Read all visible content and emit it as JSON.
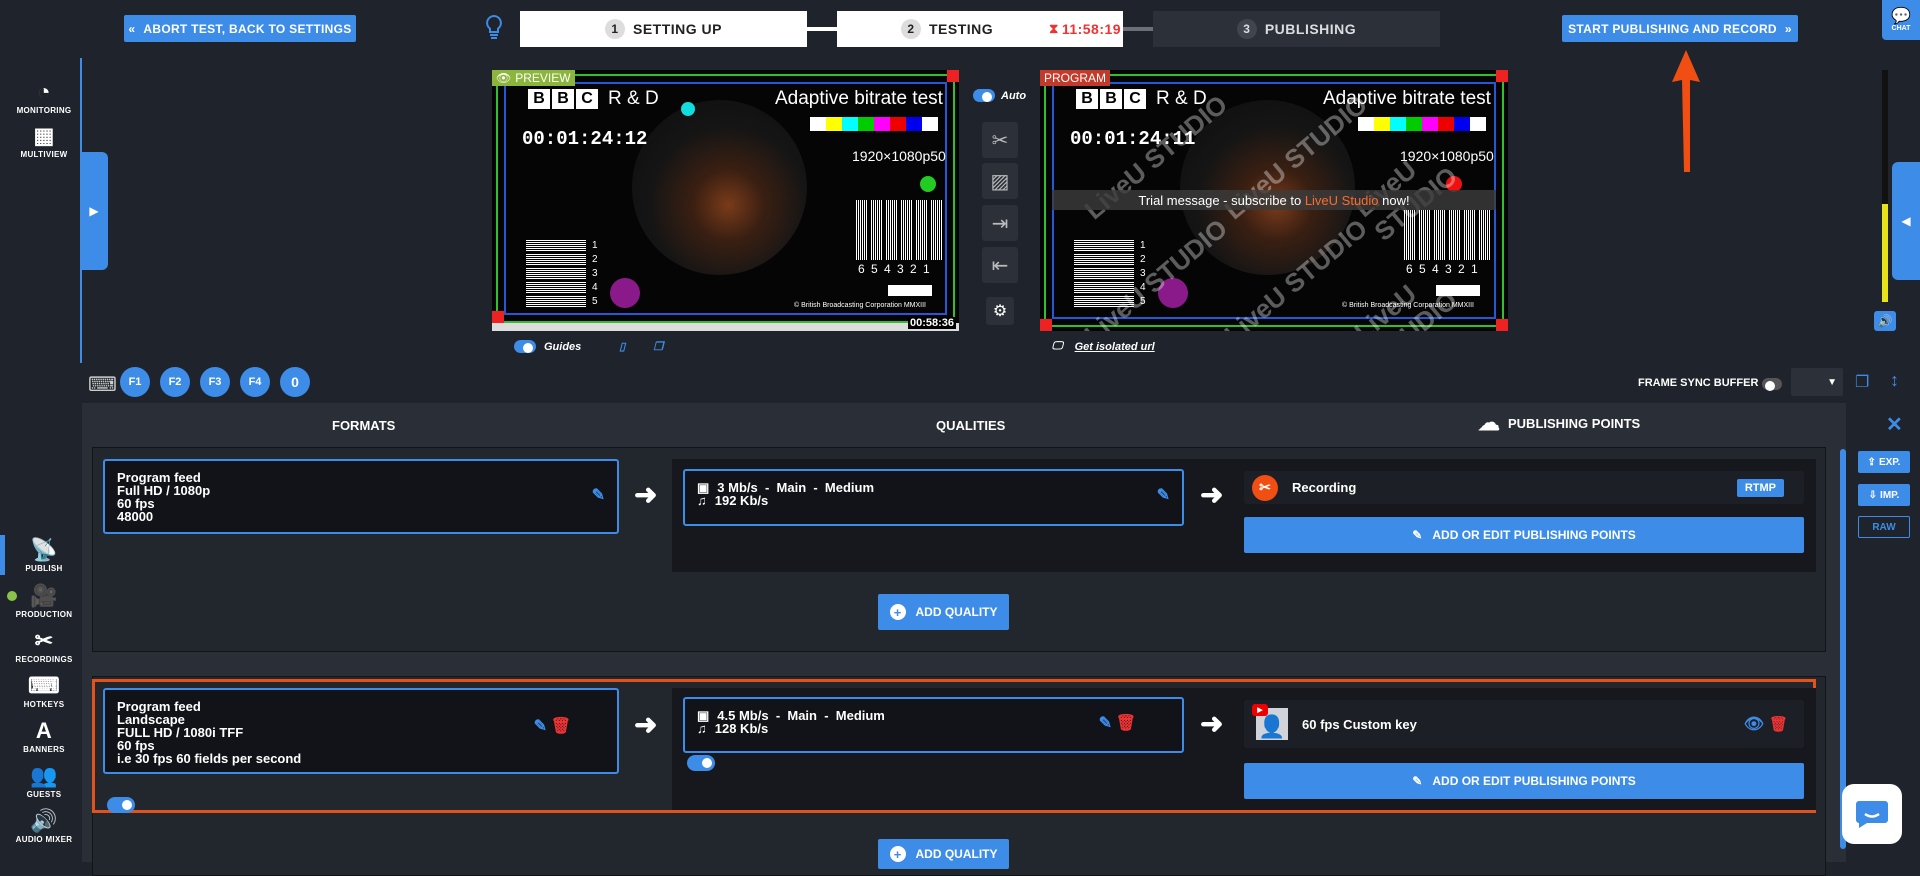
{
  "topbar": {
    "abort_label": "ABORT TEST, BACK TO SETTINGS",
    "steps": [
      {
        "num": "1",
        "label": "SETTING UP"
      },
      {
        "num": "2",
        "label": "TESTING",
        "timer": "11:58:19"
      },
      {
        "num": "3",
        "label": "PUBLISHING"
      }
    ],
    "start_label": "START PUBLISHING AND RECORD",
    "chat_label": "CHAT"
  },
  "nav": {
    "top": [
      {
        "label": "MONITORING",
        "icon": "gauge-icon"
      },
      {
        "label": "MULTIVIEW",
        "icon": "grid-icon"
      }
    ],
    "bottom": [
      {
        "label": "PUBLISH",
        "icon": "satellite-icon"
      },
      {
        "label": "PRODUCTION",
        "icon": "camera-icon"
      },
      {
        "label": "RECORDINGS",
        "icon": "scissors-icon"
      },
      {
        "label": "HOTKEYS",
        "icon": "keyboard-icon"
      },
      {
        "label": "BANNERS",
        "icon": "letter-a-icon"
      },
      {
        "label": "GUESTS",
        "icon": "users-icon"
      },
      {
        "label": "AUDIO MIXER",
        "icon": "speaker-icon"
      }
    ]
  },
  "preview": {
    "label": "PREVIEW",
    "brand": "R & D",
    "title": "Adaptive bitrate test",
    "timecode": "00:01:24:12",
    "resolution": "1920×1080p50",
    "bar_numbers": "6 5 4 3 2 1",
    "hbar_numbers": [
      "1",
      "2",
      "3",
      "4",
      "5"
    ],
    "copyright": "© British Broadcasting Corporation MMXIII",
    "remaining": "00:58:36",
    "guides_label": "Guides"
  },
  "program": {
    "label": "PROGRAM",
    "brand": "R & D",
    "title": "Adaptive bitrate test",
    "timecode": "00:01:24:11",
    "resolution": "1920×1080p50",
    "bar_numbers": "6 5 4 3 2 1",
    "hbar_numbers": [
      "1",
      "2",
      "3",
      "4",
      "5"
    ],
    "copyright": "© British Broadcasting Corporation MMXIII",
    "watermark": "LiveU STUDIO",
    "trial_prefix": "Trial message - subscribe to ",
    "trial_brand": "LiveU Studio",
    "trial_suffix": " now!",
    "isolated_url": "Get isolated url"
  },
  "tools": {
    "auto_label": "Auto"
  },
  "hotkeys": [
    "F1",
    "F2",
    "F3",
    "F4",
    "0"
  ],
  "frame_sync_label": "FRAME SYNC BUFFER",
  "headers": {
    "formats": "FORMATS",
    "qualities": "QUALITIES",
    "publishing_points": "PUBLISHING POINTS"
  },
  "groups": [
    {
      "format_lines": [
        "Program feed",
        "Full HD / 1080p",
        "60 fps",
        "48000"
      ],
      "quality_video": "3 Mb/s  -  Main  -  Medium",
      "quality_audio": "192 Kb/s",
      "point_name": "Recording",
      "point_tag": "RTMP",
      "add_points_label": "ADD OR EDIT PUBLISHING POINTS",
      "add_quality_label": "ADD QUALITY"
    },
    {
      "format_lines": [
        "Program feed",
        "Landscape",
        "FULL HD / 1080i TFF",
        "60 fps",
        "i.e 30 fps 60 fields per second"
      ],
      "quality_video": "4.5 Mb/s  -  Main  -  Medium",
      "quality_audio": "128 Kb/s",
      "point_name": "60 fps Custom key",
      "add_points_label": "ADD OR EDIT PUBLISHING POINTS",
      "add_quality_label": "ADD QUALITY"
    }
  ],
  "side_buttons": {
    "export": "EXP.",
    "import": "IMP.",
    "raw": "RAW"
  },
  "colors": {
    "accent": "#3d8ce8",
    "highlight": "#e2521c",
    "background": "#1f232b",
    "danger": "#e33333"
  }
}
